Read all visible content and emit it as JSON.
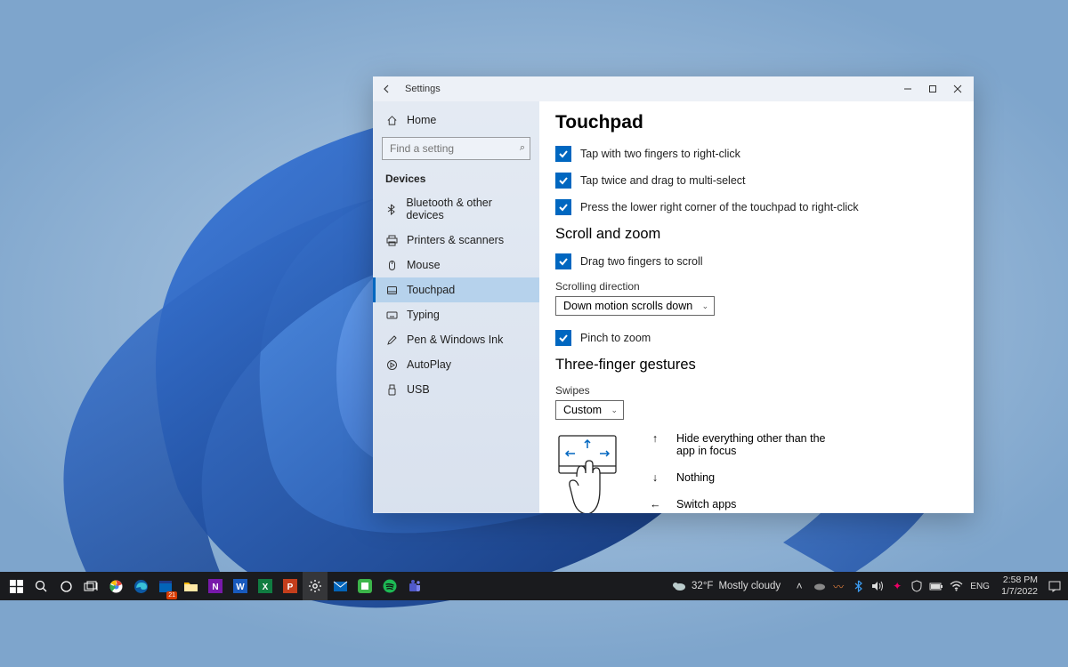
{
  "window": {
    "app_title": "Settings",
    "home_label": "Home",
    "search_placeholder": "Find a setting",
    "category": "Devices",
    "nav": [
      {
        "icon": "bluetooth",
        "label": "Bluetooth & other devices"
      },
      {
        "icon": "printer",
        "label": "Printers & scanners"
      },
      {
        "icon": "mouse",
        "label": "Mouse"
      },
      {
        "icon": "touchpad",
        "label": "Touchpad"
      },
      {
        "icon": "typing",
        "label": "Typing"
      },
      {
        "icon": "pen",
        "label": "Pen & Windows Ink"
      },
      {
        "icon": "autoplay",
        "label": "AutoPlay"
      },
      {
        "icon": "usb",
        "label": "USB"
      }
    ],
    "active_nav_index": 3
  },
  "content": {
    "page_title": "Touchpad",
    "check_two_finger_rightclick": "Tap with two fingers to right-click",
    "check_tap_twice_drag": "Tap twice and drag to multi-select",
    "check_lower_right_corner": "Press the lower right corner of the touchpad to right-click",
    "section_scroll_zoom": "Scroll and zoom",
    "check_drag_two_scroll": "Drag two fingers to scroll",
    "scrolling_direction_label": "Scrolling direction",
    "scrolling_direction_value": "Down motion scrolls down",
    "check_pinch_zoom": "Pinch to zoom",
    "section_three_finger": "Three-finger gestures",
    "swipes_label": "Swipes",
    "swipes_value": "Custom",
    "gesture_up": "Hide everything other than the app in focus",
    "gesture_down": "Nothing",
    "gesture_left": "Switch apps"
  },
  "taskbar": {
    "weather_temp": "32°F",
    "weather_text": "Mostly cloudy",
    "calendar_badge": "21",
    "time": "2:58 PM",
    "date": "1/7/2022"
  }
}
